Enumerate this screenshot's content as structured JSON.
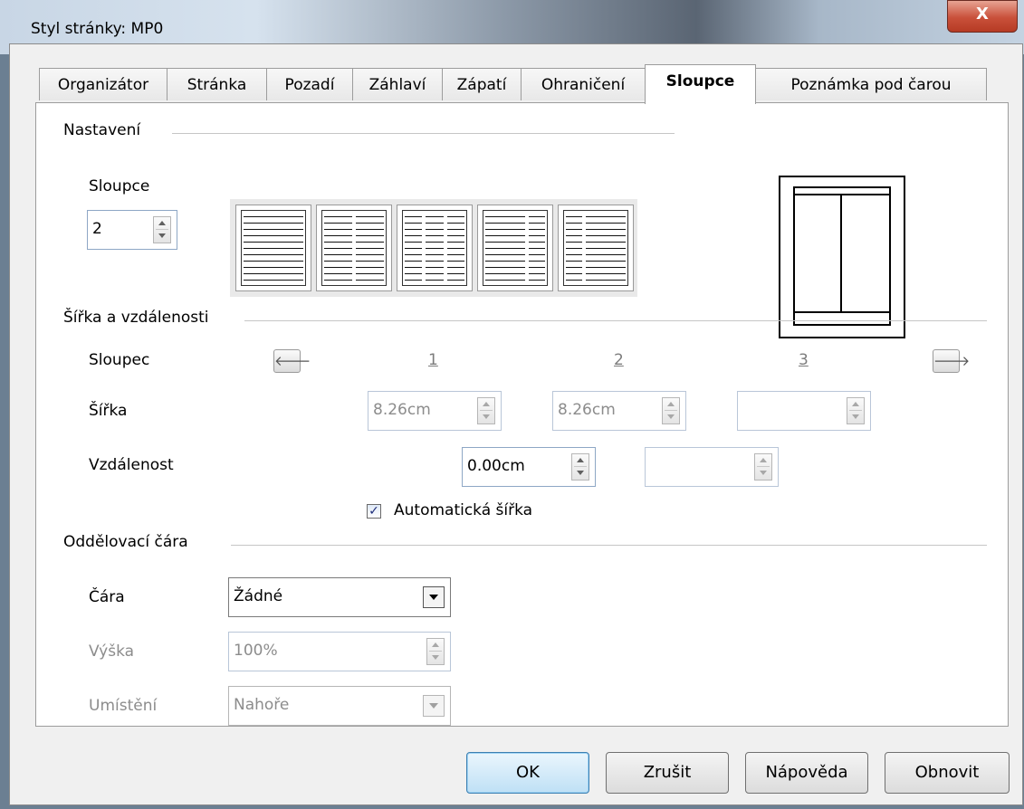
{
  "window": {
    "title": "Styl stránky: MP0",
    "close_label": "X"
  },
  "tabs": [
    {
      "label": "Organizátor"
    },
    {
      "label": "Stránka"
    },
    {
      "label": "Pozadí"
    },
    {
      "label": "Záhlaví"
    },
    {
      "label": "Zápatí"
    },
    {
      "label": "Ohraničení"
    },
    {
      "label": "Sloupce",
      "active": true
    },
    {
      "label": "Poznámka pod čarou"
    }
  ],
  "settings": {
    "section_title": "Nastavení",
    "columns_label": "Sloupce",
    "columns_value": "2"
  },
  "widths": {
    "section_title": "Šířka a vzdálenosti",
    "column_label": "Sloupec",
    "column_numbers": [
      "1",
      "2",
      "3"
    ],
    "width_label": "Šířka",
    "width_values": [
      "8.26cm",
      "8.26cm",
      ""
    ],
    "spacing_label": "Vzdálenost",
    "spacing_values": [
      "0.00cm",
      ""
    ],
    "auto_width_label": "Automatická šířka",
    "auto_width_checked": true,
    "prev_arrow": "🡐",
    "next_arrow": "🡒"
  },
  "separator": {
    "section_title": "Oddělovací čára",
    "line_label": "Čára",
    "line_value": "Žádné",
    "height_label": "Výška",
    "height_value": "100%",
    "position_label": "Umístění",
    "position_value": "Nahoře"
  },
  "buttons": {
    "ok": "OK",
    "cancel": "Zrušit",
    "help": "Nápověda",
    "reset": "Obnovit"
  }
}
